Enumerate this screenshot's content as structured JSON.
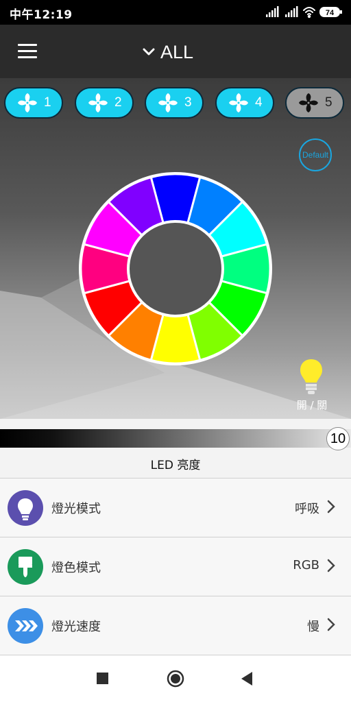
{
  "status_bar": {
    "time": "中午12:19",
    "battery": "74"
  },
  "header": {
    "title": "ALL"
  },
  "fans": [
    {
      "label": "1",
      "active": true
    },
    {
      "label": "2",
      "active": true
    },
    {
      "label": "3",
      "active": true
    },
    {
      "label": "4",
      "active": true
    },
    {
      "label": "5",
      "active": false
    }
  ],
  "default_label": "Default",
  "color_wheel": {
    "colors": [
      "#0000ff",
      "#0080ff",
      "#00ffff",
      "#00ff80",
      "#00ff00",
      "#80ff00",
      "#ffff00",
      "#ff8000",
      "#ff0000",
      "#ff0080",
      "#ff00ff",
      "#8000ff"
    ]
  },
  "power_label": "開 / 關",
  "brightness": {
    "value": "10",
    "label": "LED 亮度",
    "level": 1.0
  },
  "settings": [
    {
      "label": "燈光模式",
      "value": "呼吸",
      "icon": "bulb-icon",
      "color": "#5b4fae"
    },
    {
      "label": "燈色模式",
      "value": "RGB",
      "icon": "paint-brush-icon",
      "color": "#1a9a5a"
    },
    {
      "label": "燈光速度",
      "value": "慢",
      "icon": "fast-forward-icon",
      "color": "#3d8fe6"
    }
  ]
}
